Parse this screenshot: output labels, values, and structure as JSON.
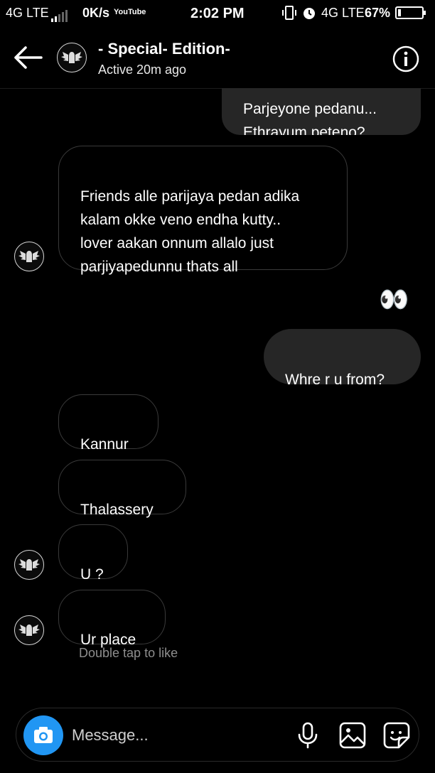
{
  "status_bar": {
    "left_network": "4G LTE",
    "data_speed": "0K/s",
    "youtube_badge": "YouTube",
    "time": "2:02 PM",
    "right_network": "4G LTE",
    "battery": "67%"
  },
  "header": {
    "title": "- Special- Edition-",
    "subtitle": "Active 20m ago",
    "back_icon": "arrow-left-icon",
    "info_icon": "info-circle-icon"
  },
  "messages": [
    {
      "sender": "me",
      "text": "Parjeyone pedanu...\nEthrayum peteno?"
    },
    {
      "sender": "them",
      "text": "Friends alle parijaya pedan adika\nkalam okke veno endha kutty..\nlover aakan onnum allalo just\nparjiyapedunnu thats all"
    },
    {
      "sender": "me",
      "text": "👀"
    },
    {
      "sender": "me",
      "text": "Whre r u from?"
    },
    {
      "sender": "them",
      "text": "Kannur"
    },
    {
      "sender": "them",
      "text": "Thalassery"
    },
    {
      "sender": "them",
      "text": "U ?"
    },
    {
      "sender": "them",
      "text": "Ur place"
    }
  ],
  "hint": "Double tap to like",
  "composer": {
    "placeholder": "Message...",
    "camera_icon": "camera-icon",
    "mic_icon": "microphone-icon",
    "gallery_icon": "image-icon",
    "sticker_icon": "sticker-icon"
  },
  "colors": {
    "background": "#000000",
    "outgoing_bubble": "#262626",
    "incoming_border": "#3a3a3a",
    "camera_button": "#2196f3",
    "hint_text": "#8e8e8e"
  }
}
